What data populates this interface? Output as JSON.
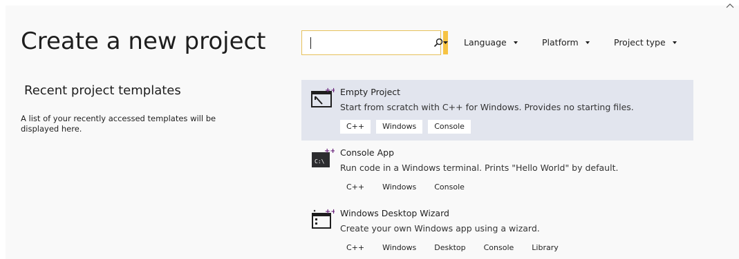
{
  "page": {
    "title": "Create a new project"
  },
  "recent": {
    "heading": "Recent project templates",
    "description": "A list of your recently accessed templates will be displayed here."
  },
  "search": {
    "value": "",
    "placeholder": ""
  },
  "filters": [
    {
      "label": "Language"
    },
    {
      "label": "Platform"
    },
    {
      "label": "Project type"
    }
  ],
  "templates": [
    {
      "name": "Empty Project",
      "description": "Start from scratch with C++ for Windows. Provides no starting files.",
      "tags": [
        "C++",
        "Windows",
        "Console"
      ],
      "selected": true,
      "icon": "empty-project-icon"
    },
    {
      "name": "Console App",
      "description": "Run code in a Windows terminal. Prints \"Hello World\" by default.",
      "tags": [
        "C++",
        "Windows",
        "Console"
      ],
      "selected": false,
      "icon": "console-app-icon"
    },
    {
      "name": "Windows Desktop Wizard",
      "description": "Create your own Windows app using a wizard.",
      "tags": [
        "C++",
        "Windows",
        "Desktop",
        "Console",
        "Library"
      ],
      "selected": false,
      "icon": "desktop-wizard-icon"
    }
  ],
  "colors": {
    "accent": "#f6c343",
    "selected_row": "#e2e5ee",
    "icon_purple": "#68217a"
  }
}
